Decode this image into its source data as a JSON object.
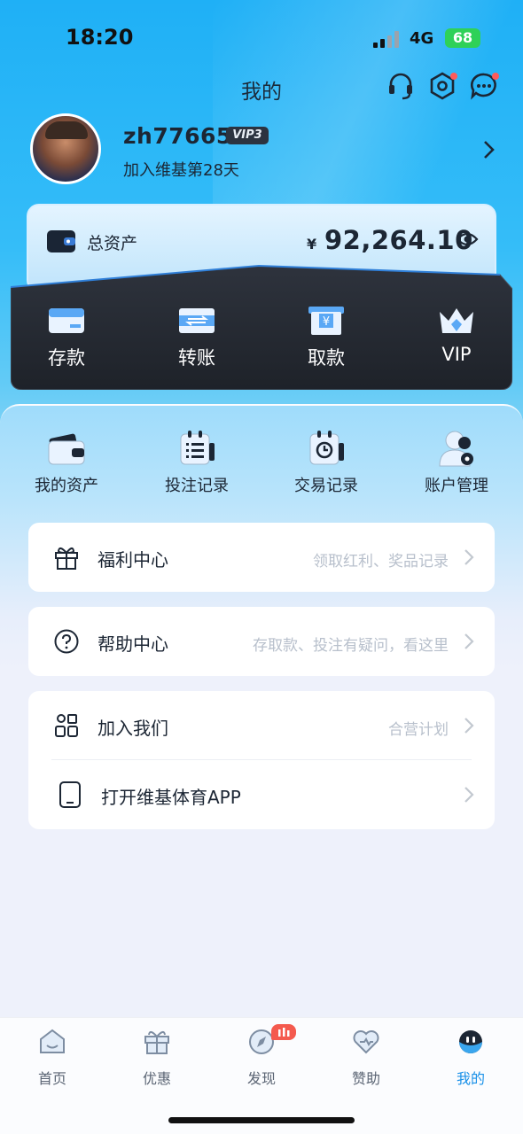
{
  "status_bar": {
    "time": "18:20",
    "network": "4G",
    "battery": "68"
  },
  "header": {
    "title": "我的"
  },
  "profile": {
    "username": "zh776655",
    "vip_badge": "VIP3",
    "joined": "加入维基第28天"
  },
  "assets": {
    "label": "总资产",
    "currency": "¥",
    "amount": "92,264.10"
  },
  "actions": [
    {
      "label": "存款",
      "icon": "deposit-card-icon"
    },
    {
      "label": "转账",
      "icon": "transfer-icon"
    },
    {
      "label": "取款",
      "icon": "withdraw-icon"
    },
    {
      "label": "VIP",
      "icon": "crown-icon"
    }
  ],
  "tools": [
    {
      "label": "我的资产",
      "icon": "wallet-icon"
    },
    {
      "label": "投注记录",
      "icon": "bet-record-icon"
    },
    {
      "label": "交易记录",
      "icon": "transaction-record-icon"
    },
    {
      "label": "账户管理",
      "icon": "account-settings-icon"
    }
  ],
  "menu": {
    "welfare": {
      "title": "福利中心",
      "hint": "领取红利、奖品记录"
    },
    "help": {
      "title": "帮助中心",
      "hint": "存取款、投注有疑问，看这里"
    },
    "join": {
      "title": "加入我们",
      "hint": "合营计划"
    },
    "app": {
      "title": "打开维基体育APP",
      "hint": ""
    }
  },
  "tabs": [
    {
      "label": "首页",
      "icon": "home-icon"
    },
    {
      "label": "优惠",
      "icon": "gift-icon"
    },
    {
      "label": "发现",
      "icon": "compass-icon"
    },
    {
      "label": "赞助",
      "icon": "heart-icon"
    },
    {
      "label": "我的",
      "icon": "profile-face-icon"
    }
  ],
  "colors": {
    "accent": "#1890e8",
    "hero": "#1fb0f6",
    "dark_card": "#262a33",
    "badge": "#f45a4e"
  }
}
